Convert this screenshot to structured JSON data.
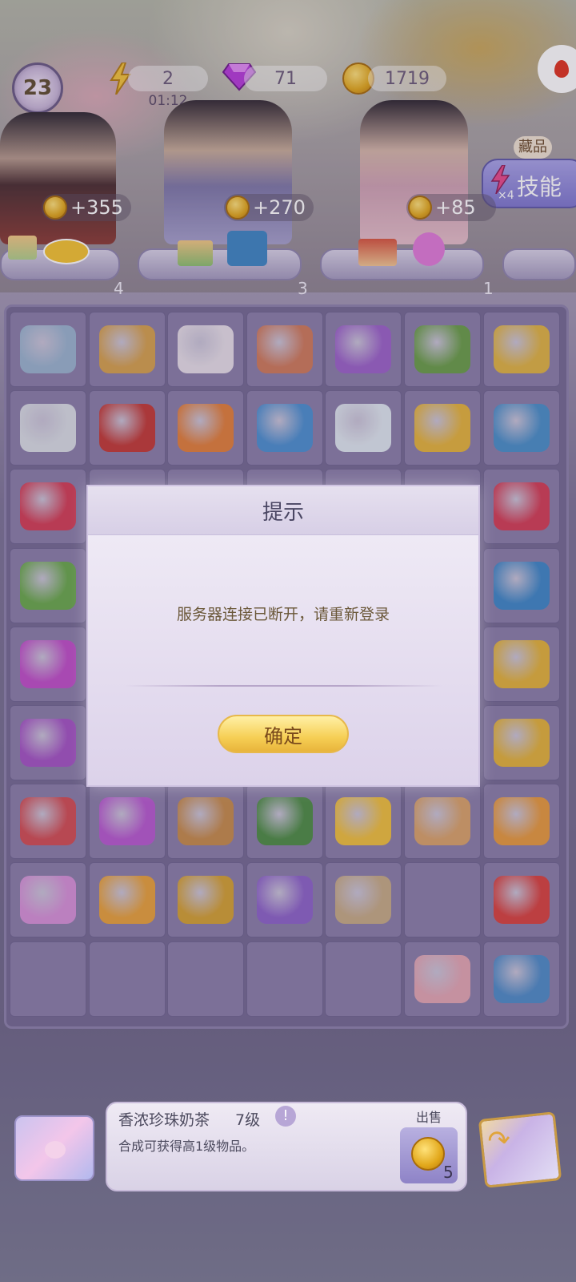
{
  "hud": {
    "level": "23",
    "energy": "2",
    "energy_timer": "01:12",
    "gems": "71",
    "coins": "1719"
  },
  "side": {
    "collection_label": "藏品",
    "skill_label": "技能",
    "skill_multiplier": "×4"
  },
  "customers": [
    {
      "reward": "+355",
      "shelf_count": "4"
    },
    {
      "reward": "+270",
      "shelf_count": "3"
    },
    {
      "reward": "+85",
      "shelf_count": "1"
    }
  ],
  "dialog": {
    "title": "提示",
    "message": "服务器连接已断开，请重新登录",
    "confirm_label": "确定"
  },
  "selected_item": {
    "name": "香浓珍珠奶茶",
    "level": "7级",
    "description": "合成可获得高1级物品。",
    "sell_label": "出售",
    "sell_price": "5"
  },
  "colors": {
    "board_bg": "#756a93",
    "cell_bg": "#8a7ea9",
    "accent_gold": "#f6cf55",
    "dialog_bg": "#efeaf4"
  }
}
